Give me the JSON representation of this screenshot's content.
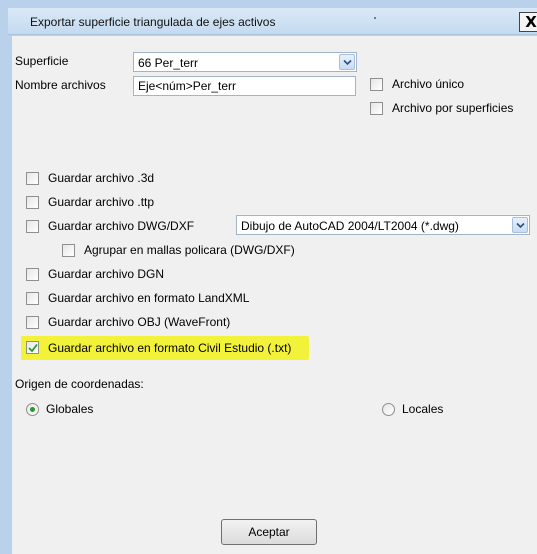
{
  "window": {
    "title": "Exportar superficie triangulada de ejes activos",
    "close_glyph": "X"
  },
  "superficie": {
    "label": "Superficie",
    "value": "66 Per_terr"
  },
  "nombre_archivos": {
    "label": "Nombre archivos",
    "value": "Eje<núm>Per_terr"
  },
  "archivo_unico": {
    "label": "Archivo único",
    "checked": false
  },
  "archivo_por_superficies": {
    "label": "Archivo por superficies",
    "checked": false
  },
  "options": [
    {
      "label": "Guardar archivo .3d",
      "checked": false
    },
    {
      "label": "Guardar archivo .ttp",
      "checked": false
    },
    {
      "label": "Guardar archivo DWG/DXF",
      "checked": false
    },
    {
      "label": "Agrupar en mallas policara (DWG/DXF)",
      "checked": false
    },
    {
      "label": "Guardar archivo DGN",
      "checked": false
    },
    {
      "label": "Guardar archivo en formato LandXML",
      "checked": false
    },
    {
      "label": "Guardar archivo OBJ (WaveFront)",
      "checked": false
    },
    {
      "label": "Guardar archivo en formato Civil Estudio (.txt)",
      "checked": true
    }
  ],
  "dwg_format": {
    "value": "Dibujo de AutoCAD 2004/LT2004 (*.dwg)"
  },
  "origen": {
    "label": "Origen de coordenadas:",
    "globales": {
      "label": "Globales",
      "selected": true
    },
    "locales": {
      "label": "Locales",
      "selected": false
    }
  },
  "accept_button": {
    "label": "Aceptar"
  },
  "colors": {
    "highlight": "#f2f23a",
    "check_green": "#2a9a2a",
    "window_frame": "#b9d1ea"
  },
  "icons": {
    "close": "close-icon",
    "dropdown": "chevron-down-icon",
    "check": "checkmark-icon"
  }
}
